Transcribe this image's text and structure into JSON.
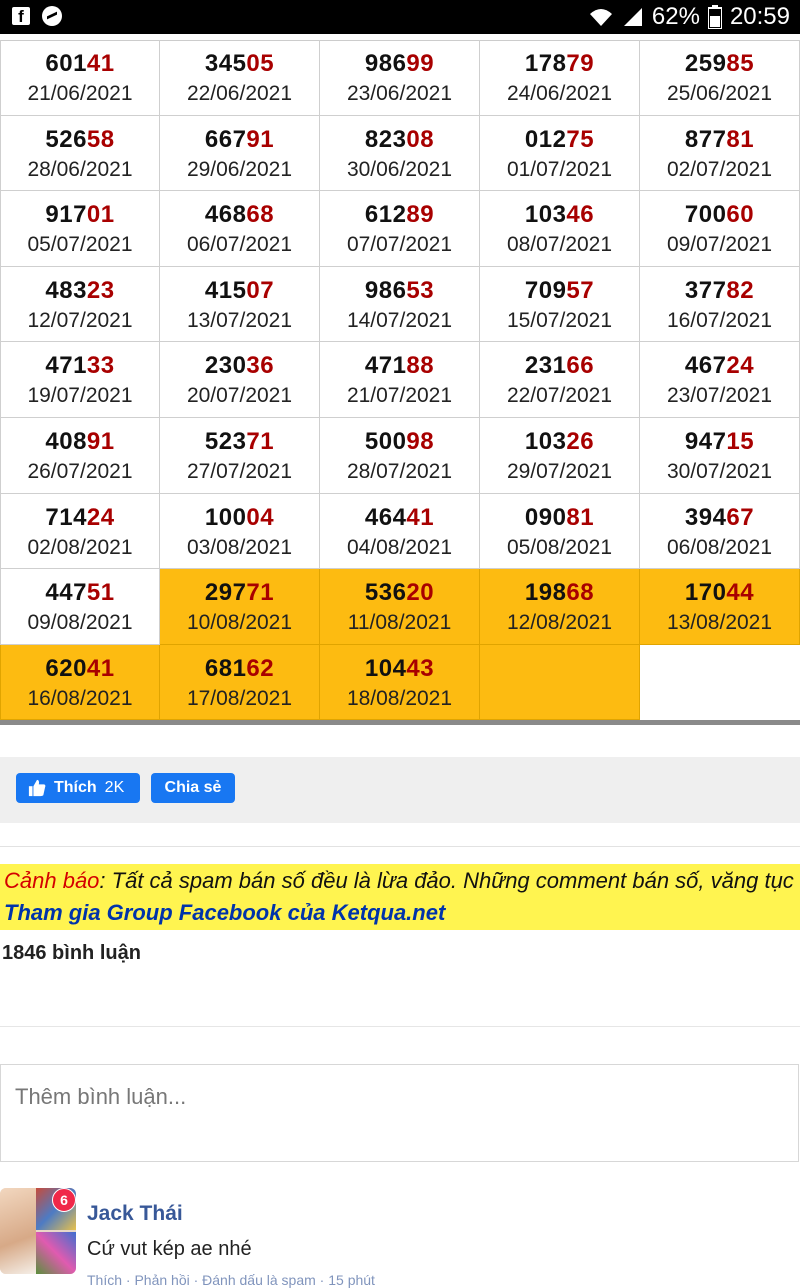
{
  "status_bar": {
    "battery": "62%",
    "time": "20:59",
    "left_icons": [
      "facebook-icon",
      "messenger-icon"
    ],
    "right_icons": [
      "wifi-icon",
      "signal-icon",
      "battery-icon"
    ]
  },
  "results": {
    "rows": [
      [
        {
          "lead": "601",
          "tail": "41",
          "date": "21/06/2021",
          "highlight": false
        },
        {
          "lead": "345",
          "tail": "05",
          "date": "22/06/2021",
          "highlight": false
        },
        {
          "lead": "986",
          "tail": "99",
          "date": "23/06/2021",
          "highlight": false
        },
        {
          "lead": "178",
          "tail": "79",
          "date": "24/06/2021",
          "highlight": false
        },
        {
          "lead": "259",
          "tail": "85",
          "date": "25/06/2021",
          "highlight": false
        }
      ],
      [
        {
          "lead": "526",
          "tail": "58",
          "date": "28/06/2021",
          "highlight": false
        },
        {
          "lead": "667",
          "tail": "91",
          "date": "29/06/2021",
          "highlight": false
        },
        {
          "lead": "823",
          "tail": "08",
          "date": "30/06/2021",
          "highlight": false
        },
        {
          "lead": "012",
          "tail": "75",
          "date": "01/07/2021",
          "highlight": false
        },
        {
          "lead": "877",
          "tail": "81",
          "date": "02/07/2021",
          "highlight": false
        }
      ],
      [
        {
          "lead": "917",
          "tail": "01",
          "date": "05/07/2021",
          "highlight": false
        },
        {
          "lead": "468",
          "tail": "68",
          "date": "06/07/2021",
          "highlight": false
        },
        {
          "lead": "612",
          "tail": "89",
          "date": "07/07/2021",
          "highlight": false
        },
        {
          "lead": "103",
          "tail": "46",
          "date": "08/07/2021",
          "highlight": false
        },
        {
          "lead": "700",
          "tail": "60",
          "date": "09/07/2021",
          "highlight": false
        }
      ],
      [
        {
          "lead": "483",
          "tail": "23",
          "date": "12/07/2021",
          "highlight": false
        },
        {
          "lead": "415",
          "tail": "07",
          "date": "13/07/2021",
          "highlight": false
        },
        {
          "lead": "986",
          "tail": "53",
          "date": "14/07/2021",
          "highlight": false
        },
        {
          "lead": "709",
          "tail": "57",
          "date": "15/07/2021",
          "highlight": false
        },
        {
          "lead": "377",
          "tail": "82",
          "date": "16/07/2021",
          "highlight": false
        }
      ],
      [
        {
          "lead": "471",
          "tail": "33",
          "date": "19/07/2021",
          "highlight": false
        },
        {
          "lead": "230",
          "tail": "36",
          "date": "20/07/2021",
          "highlight": false
        },
        {
          "lead": "471",
          "tail": "88",
          "date": "21/07/2021",
          "highlight": false
        },
        {
          "lead": "231",
          "tail": "66",
          "date": "22/07/2021",
          "highlight": false
        },
        {
          "lead": "467",
          "tail": "24",
          "date": "23/07/2021",
          "highlight": false
        }
      ],
      [
        {
          "lead": "408",
          "tail": "91",
          "date": "26/07/2021",
          "highlight": false
        },
        {
          "lead": "523",
          "tail": "71",
          "date": "27/07/2021",
          "highlight": false
        },
        {
          "lead": "500",
          "tail": "98",
          "date": "28/07/2021",
          "highlight": false
        },
        {
          "lead": "103",
          "tail": "26",
          "date": "29/07/2021",
          "highlight": false
        },
        {
          "lead": "947",
          "tail": "15",
          "date": "30/07/2021",
          "highlight": false
        }
      ],
      [
        {
          "lead": "714",
          "tail": "24",
          "date": "02/08/2021",
          "highlight": false
        },
        {
          "lead": "100",
          "tail": "04",
          "date": "03/08/2021",
          "highlight": false
        },
        {
          "lead": "464",
          "tail": "41",
          "date": "04/08/2021",
          "highlight": false
        },
        {
          "lead": "090",
          "tail": "81",
          "date": "05/08/2021",
          "highlight": false
        },
        {
          "lead": "394",
          "tail": "67",
          "date": "06/08/2021",
          "highlight": false
        }
      ],
      [
        {
          "lead": "447",
          "tail": "51",
          "date": "09/08/2021",
          "highlight": false
        },
        {
          "lead": "297",
          "tail": "71",
          "date": "10/08/2021",
          "highlight": true
        },
        {
          "lead": "536",
          "tail": "20",
          "date": "11/08/2021",
          "highlight": true
        },
        {
          "lead": "198",
          "tail": "68",
          "date": "12/08/2021",
          "highlight": true
        },
        {
          "lead": "170",
          "tail": "44",
          "date": "13/08/2021",
          "highlight": true
        }
      ],
      [
        {
          "lead": "620",
          "tail": "41",
          "date": "16/08/2021",
          "highlight": true
        },
        {
          "lead": "681",
          "tail": "62",
          "date": "17/08/2021",
          "highlight": true
        },
        {
          "lead": "104",
          "tail": "43",
          "date": "18/08/2021",
          "highlight": true
        },
        {
          "lead": "",
          "tail": "",
          "date": "",
          "highlight": true
        },
        {
          "lead": "",
          "tail": "",
          "date": "",
          "highlight": false,
          "blank": true
        }
      ]
    ],
    "colors": {
      "highlight": "#fdbb11",
      "tail_digits": "#a80000"
    }
  },
  "social": {
    "like_label": "Thích",
    "like_count": "2K",
    "share_label": "Chia sẻ"
  },
  "warning": {
    "prefix": "Cảnh báo",
    "text": ": Tất cả spam bán số đều là lừa đảo. Những comment bán số, văng tục",
    "link": "Tham gia Group Facebook của Ketqua.net"
  },
  "comments": {
    "count_label": "1846 bình luận",
    "input_placeholder": "Thêm bình luận...",
    "items": [
      {
        "name": "Jack Thái",
        "text": "Cứ vut kép ae nhé",
        "badge": "6",
        "actions": "Thích · Phản hồi · Đánh dấu là spam · 15 phút"
      }
    ]
  }
}
